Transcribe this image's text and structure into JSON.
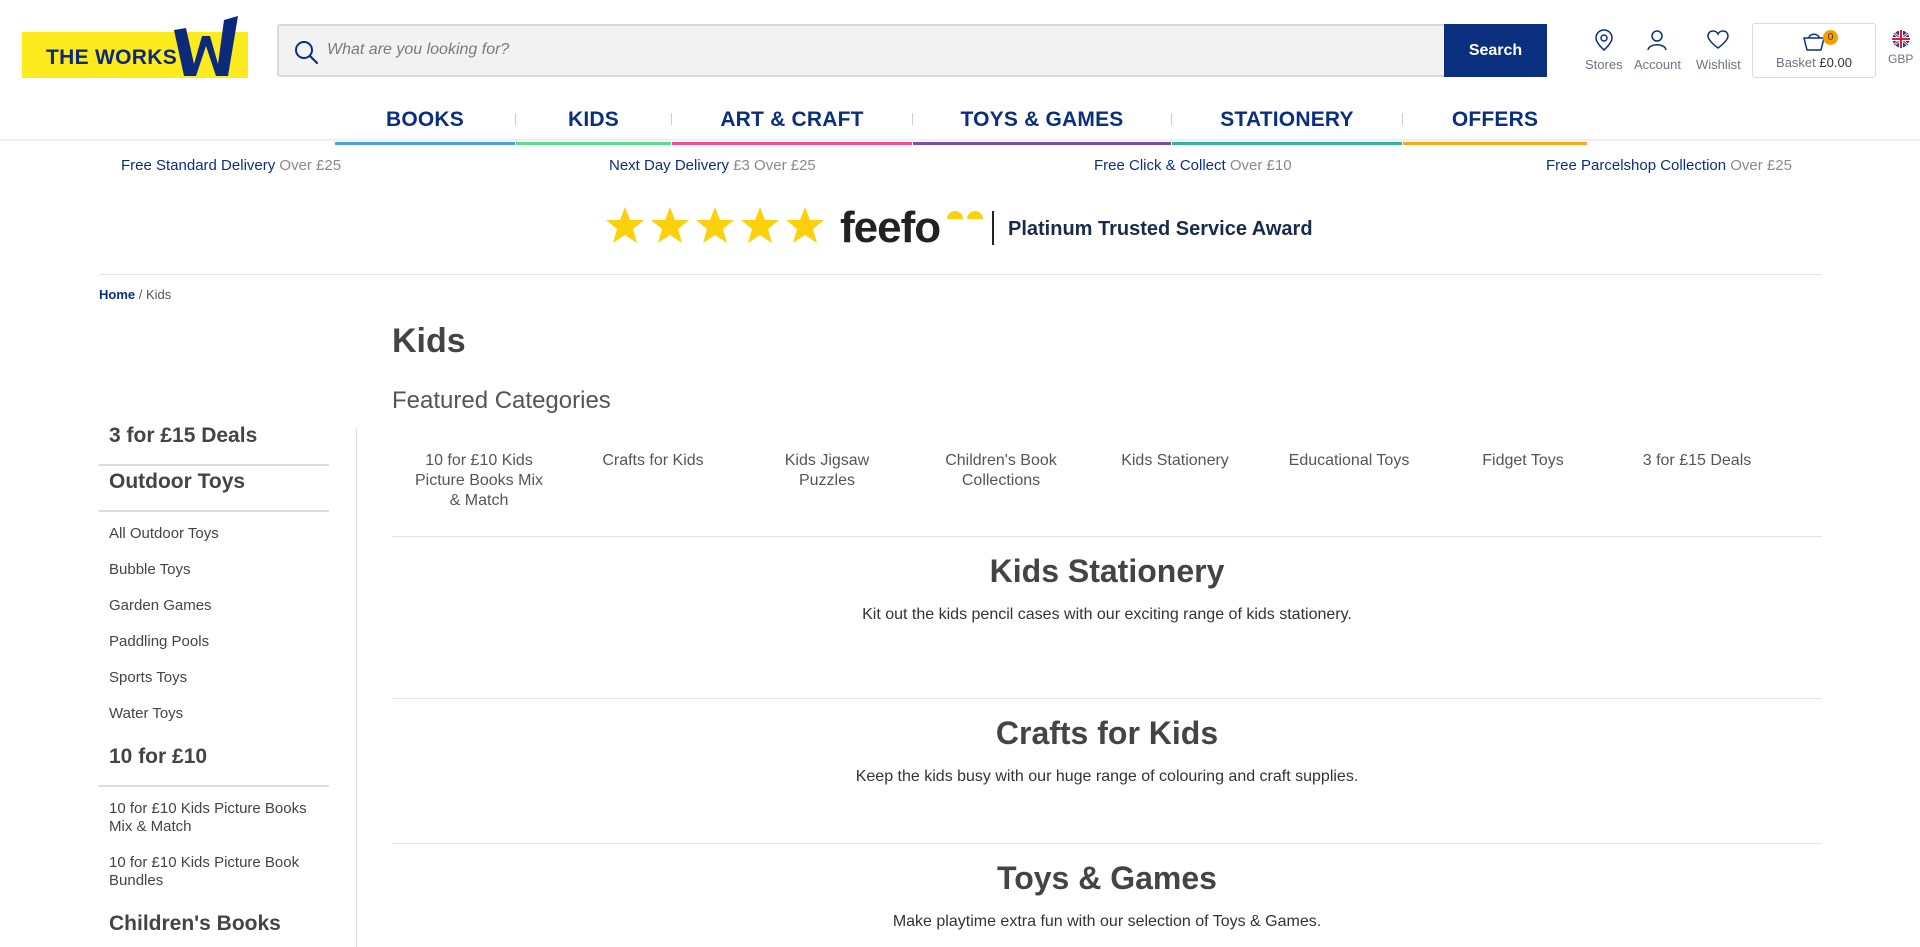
{
  "header": {
    "logo_text": "THE WORKS",
    "search_placeholder": "What are you looking for?",
    "search_button": "Search",
    "stores": "Stores",
    "account": "Account",
    "wishlist": "Wishlist",
    "basket_label": "Basket",
    "basket_total": "£0.00",
    "basket_count": "0",
    "currency": "GBP"
  },
  "nav": [
    {
      "label": "BOOKS",
      "color": "#4aa3df"
    },
    {
      "label": "KIDS",
      "color": "#5fdc8a"
    },
    {
      "label": "ART & CRAFT",
      "color": "#f0508f"
    },
    {
      "label": "TOYS & GAMES",
      "color": "#7a4fa8"
    },
    {
      "label": "STATIONERY",
      "color": "#36b39c"
    },
    {
      "label": "OFFERS",
      "color": "#f7a81c"
    }
  ],
  "delivery": [
    {
      "bold": "Free Standard Delivery",
      "rest": "Over £25"
    },
    {
      "bold": "Next Day Delivery",
      "rest": "£3 Over £25"
    },
    {
      "bold": "Free Click & Collect",
      "rest": "Over £10"
    },
    {
      "bold": "Free Parcelshop Collection",
      "rest": "Over £25"
    }
  ],
  "feefo": {
    "brand": "feefo",
    "award": "Platinum Trusted Service Award",
    "star_color": "#fcd10b"
  },
  "breadcrumb": {
    "home": "Home",
    "sep": "/",
    "current": "Kids"
  },
  "page": {
    "title": "Kids",
    "featured_heading": "Featured Categories"
  },
  "featured_categories": [
    "10 for £10 Kids Picture Books Mix & Match",
    "Crafts for Kids",
    "Kids Jigsaw Puzzles",
    "Children's Book Collections",
    "Kids Stationery",
    "Educational Toys",
    "Fidget Toys",
    "3 for £15 Deals"
  ],
  "sidebar": {
    "deals": "3 for £15 Deals",
    "outdoor_heading": "Outdoor Toys",
    "outdoor": [
      "All Outdoor Toys",
      "Bubble Toys",
      "Garden Games",
      "Paddling Pools",
      "Sports Toys",
      "Water Toys"
    ],
    "ten_heading": "10 for £10",
    "ten": [
      "10 for £10 Kids Picture Books Mix & Match",
      "10 for £10 Kids Picture Book Bundles"
    ],
    "books_heading": "Children's Books"
  },
  "sections": [
    {
      "title": "Kids Stationery",
      "text": "Kit out the kids pencil cases with our exciting range of kids stationery."
    },
    {
      "title": "Crafts for Kids",
      "text": "Keep the kids busy with our huge range of colouring and craft supplies."
    },
    {
      "title": "Toys & Games",
      "text": "Make playtime extra fun with our selection of Toys & Games."
    }
  ]
}
